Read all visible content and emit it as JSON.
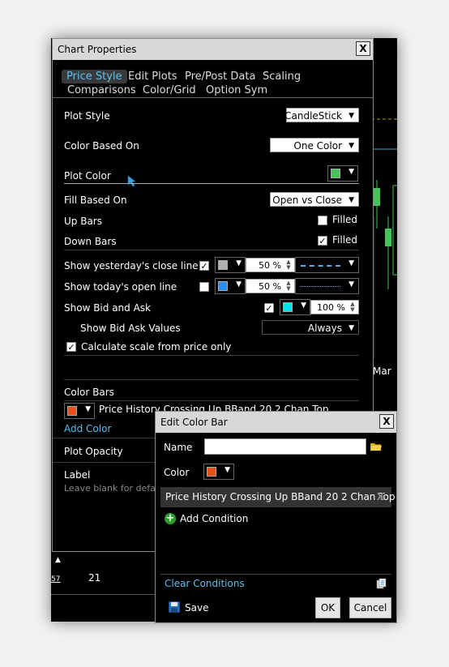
{
  "main_dialog": {
    "title": "Chart Properties",
    "close": "X",
    "tabs_row1": [
      "Price Style",
      "Edit Plots",
      "Pre/Post Data",
      "Scaling"
    ],
    "tabs_row2": [
      "Comparisons",
      "Color/Grid",
      "Option Sym"
    ],
    "plot_style": {
      "label": "Plot Style",
      "value": "CandleStick"
    },
    "color_based_on": {
      "label": "Color Based On",
      "value": "One Color"
    },
    "plot_color": {
      "label": "Plot Color",
      "color": "#45c45a"
    },
    "fill_based_on": {
      "label": "Fill Based On",
      "value": "Open vs Close"
    },
    "up_bars": {
      "label": "Up Bars",
      "check_label": "Filled",
      "checked": false
    },
    "down_bars": {
      "label": "Down Bars",
      "check_label": "Filled",
      "checked": true
    },
    "yesterday_close": {
      "label": "Show yesterday's close line",
      "checked": true,
      "color": "#b0b0b0",
      "opacity": "50 %"
    },
    "today_open": {
      "label": "Show today's open line",
      "checked": false,
      "color": "#2a8ff0",
      "opacity": "50 %"
    },
    "bid_ask": {
      "label": "Show Bid and Ask",
      "checked": true,
      "color": "#00e5f0",
      "opacity": "100 %"
    },
    "bid_ask_values": {
      "label": "Show Bid Ask Values",
      "value": "Always"
    },
    "calc_scale": {
      "label": "Calculate scale from price only",
      "checked": true
    },
    "color_bars": {
      "label": "Color Bars",
      "condition_text": "Price History Crossing Up BBand 20 2 Chan Top",
      "color": "#e8521a"
    },
    "add_color": "Add Color",
    "plot_opacity": "Plot Opacity",
    "label_field": {
      "label": "Label",
      "hint": "Leave blank for defau"
    }
  },
  "edit_dialog": {
    "title": "Edit Color Bar",
    "close": "X",
    "name_label": "Name",
    "name_value": "",
    "color_label": "Color",
    "color": "#e8521a",
    "condition": "Price History Crossing Up BBand 20 2 Chan Top",
    "condition_remove": "X",
    "add_condition": "Add Condition",
    "clear_conditions": "Clear Conditions",
    "save": "Save",
    "ok": "OK",
    "cancel": "Cancel"
  },
  "chart": {
    "month_label": "Mar",
    "tick_21": "21",
    "tick_57": "57"
  },
  "colors": {
    "accent": "#5bc0f0",
    "candle_green": "#45c45a"
  }
}
